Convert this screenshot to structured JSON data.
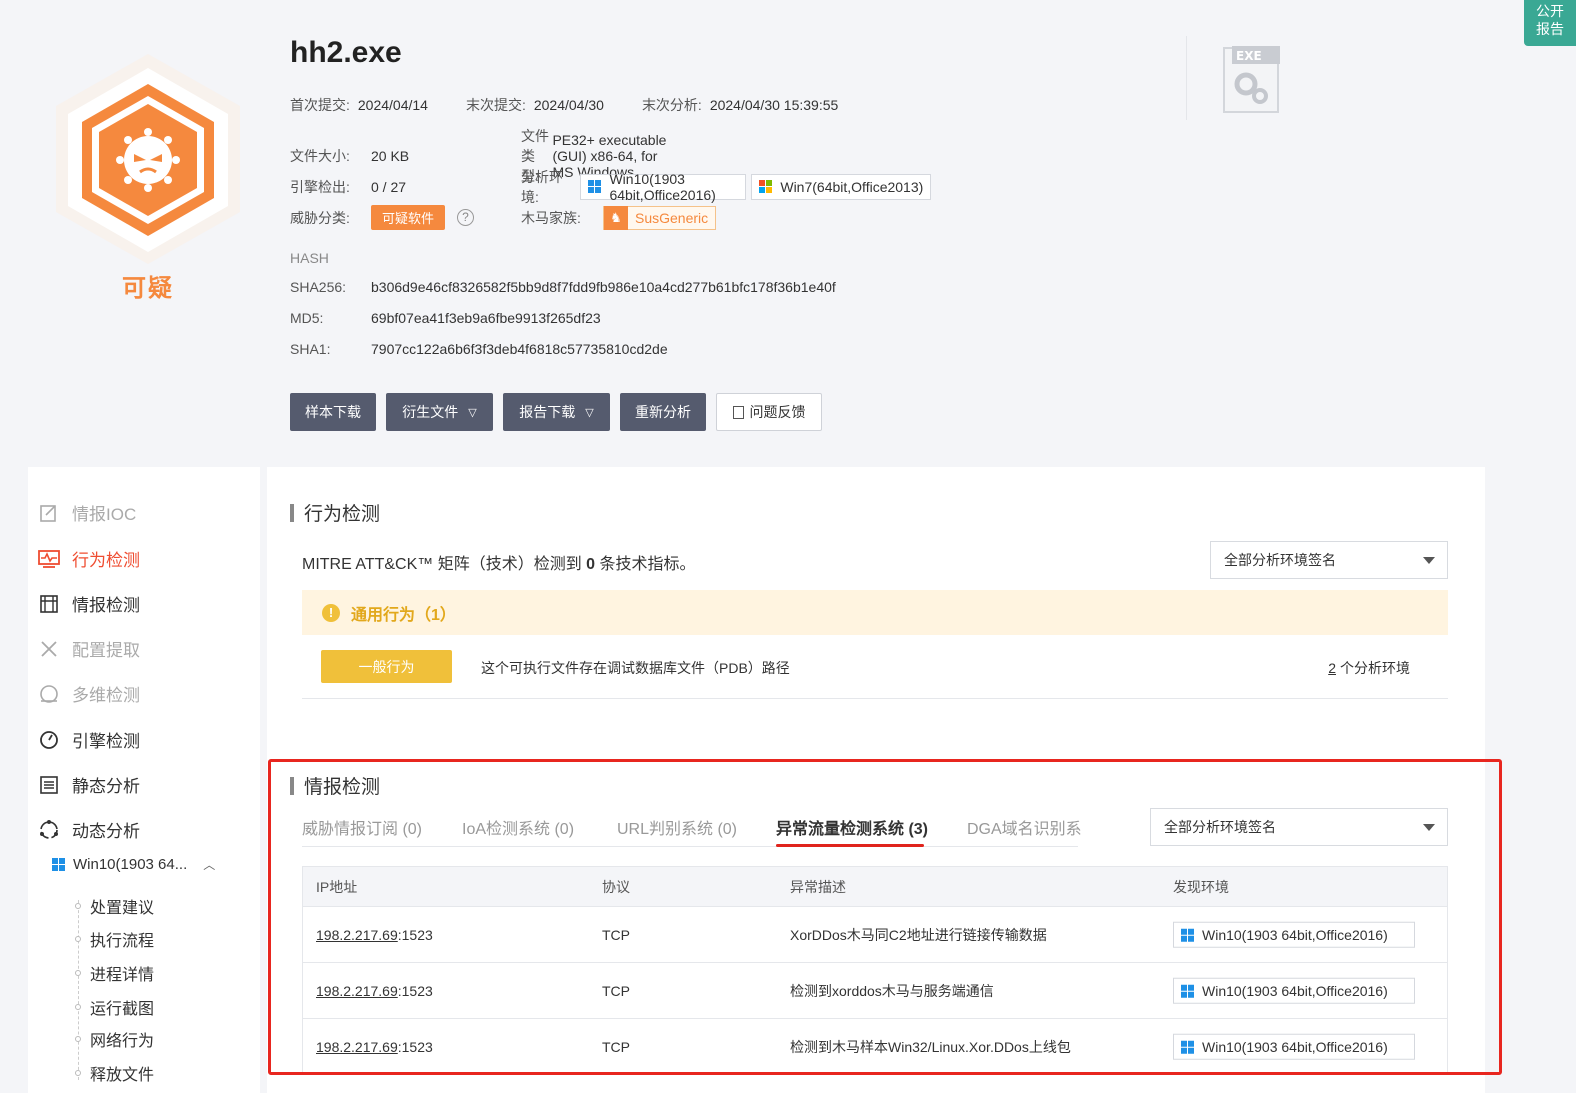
{
  "verdict": {
    "label": "可疑",
    "color": "#f5893e"
  },
  "public_report": "公开\n报告",
  "file": {
    "name": "hh2.exe",
    "first_submit_label": "首次提交:",
    "first_submit": "2024/04/14",
    "last_submit_label": "末次提交:",
    "last_submit": "2024/04/30",
    "last_analysis_label": "末次分析:",
    "last_analysis": "2024/04/30 15:39:55",
    "size_label": "文件大小:",
    "size": "20 KB",
    "engine_label": "引擎检出:",
    "engine": "0 / 27",
    "threat_label": "威胁分类:",
    "threat": "可疑软件",
    "type_label": "文件类型:",
    "type": "PE32+ executable (GUI) x86-64, for MS Windows",
    "env_label": "分析环境:",
    "envs": [
      "Win10(1903 64bit,Office2016)",
      "Win7(64bit,Office2013)"
    ],
    "family_label": "木马家族:",
    "family": "SusGeneric",
    "exe_badge": "EXE"
  },
  "hash": {
    "head": "HASH",
    "sha256_label": "SHA256:",
    "sha256": "b306d9e46cf8326582f5bb9d8f7fdd9fb986e10a4cd277b61bfc178f36b1e40f",
    "md5_label": "MD5:",
    "md5": "69bf07ea41f3eb9a6fbe9913f265df23",
    "sha1_label": "SHA1:",
    "sha1": "7907cc122a6b6f3f3deb4f6818c57735810cd2de"
  },
  "actions": {
    "sample_download": "样本下载",
    "derived_files": "衍生文件",
    "report_download": "报告下载",
    "reanalyze": "重新分析",
    "feedback": "问题反馈"
  },
  "sidebar": {
    "items": [
      "情报IOC",
      "行为检测",
      "情报检测",
      "配置提取",
      "多维检测",
      "引擎检测",
      "静态分析",
      "动态分析"
    ],
    "env": "Win10(1903 64...",
    "subitems": [
      "处置建议",
      "执行流程",
      "进程详情",
      "运行截图",
      "网络行为",
      "释放文件"
    ]
  },
  "behavior": {
    "title": "行为检测",
    "mitre_pre": "MITRE ATT&CK™ 矩阵（技术）检测到 ",
    "mitre_count": "0",
    "mitre_post": " 条技术指标。",
    "select": "全部分析环境签名",
    "banner": "通用行为（1）",
    "tag": "一般行为",
    "desc": "这个可执行文件存在调试数据库文件（PDB）路径",
    "env_count": "2",
    "env_suffix": "个分析环境"
  },
  "intel": {
    "title": "情报检测",
    "tabs": [
      "威胁情报订阅 (0)",
      "IoA检测系统 (0)",
      "URL判别系统 (0)",
      "异常流量检测系统 (3)",
      "DGA域名识别系"
    ],
    "select": "全部分析环境签名",
    "columns": [
      "IP地址",
      "协议",
      "异常描述",
      "发现环境"
    ],
    "rows": [
      {
        "ip": "198.2.217.69",
        "port": ":1523",
        "proto": "TCP",
        "desc": "XorDDos木马同C2地址进行链接传输数据",
        "env": "Win10(1903 64bit,Office2016)"
      },
      {
        "ip": "198.2.217.69",
        "port": ":1523",
        "proto": "TCP",
        "desc": "检测到xorddos木马与服务端通信",
        "env": "Win10(1903 64bit,Office2016)"
      },
      {
        "ip": "198.2.217.69",
        "port": ":1523",
        "proto": "TCP",
        "desc": "检测到木马样本Win32/Linux.Xor.DDos上线包",
        "env": "Win10(1903 64bit,Office2016)"
      }
    ]
  }
}
